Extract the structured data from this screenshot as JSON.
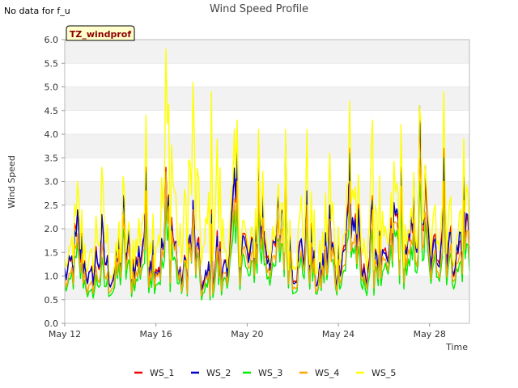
{
  "chart_data": {
    "type": "line",
    "title": "Wind Speed Profile",
    "note": "No data for f_u",
    "tag": "TZ_windprof",
    "xlabel": "Time",
    "ylabel": "Wind Speed",
    "ylim": [
      0,
      6
    ],
    "yticks": [
      "0.0",
      "0.5",
      "1.0",
      "1.5",
      "2.0",
      "2.5",
      "3.0",
      "3.5",
      "4.0",
      "4.5",
      "5.0",
      "5.5",
      "6.0"
    ],
    "x_start": "2024-05-12",
    "x_end": "2024-05-29T18:00",
    "xticks": [
      {
        "date": "2024-05-12",
        "label": "May 12"
      },
      {
        "date": "2024-05-16",
        "label": "May 16"
      },
      {
        "date": "2024-05-20",
        "label": "May 20"
      },
      {
        "date": "2024-05-24",
        "label": "May 24"
      },
      {
        "date": "2024-05-28",
        "label": "May 28"
      }
    ],
    "grid": true,
    "legend": "bottom",
    "daily_peaks": [
      {
        "date": "2024-05-12",
        "WS_1": 2.4,
        "WS_2": 2.4,
        "WS_3": 1.7,
        "WS_4": 1.9,
        "WS_5": 3.0
      },
      {
        "date": "2024-05-13",
        "WS_1": 2.3,
        "WS_2": 2.3,
        "WS_3": 1.4,
        "WS_4": 1.7,
        "WS_5": 3.3
      },
      {
        "date": "2024-05-14",
        "WS_1": 2.7,
        "WS_2": 2.7,
        "WS_3": 2.0,
        "WS_4": 2.3,
        "WS_5": 3.1
      },
      {
        "date": "2024-05-15",
        "WS_1": 3.3,
        "WS_2": 3.2,
        "WS_3": 2.4,
        "WS_4": 2.8,
        "WS_5": 4.4
      },
      {
        "date": "2024-05-16",
        "WS_1": 3.3,
        "WS_2": 3.2,
        "WS_3": 2.6,
        "WS_4": 3.2,
        "WS_5": 5.8
      },
      {
        "date": "2024-05-17",
        "WS_1": 2.6,
        "WS_2": 2.6,
        "WS_3": 2.2,
        "WS_4": 2.4,
        "WS_5": 5.1
      },
      {
        "date": "2024-05-18",
        "WS_1": 2.4,
        "WS_2": 2.3,
        "WS_3": 1.8,
        "WS_4": 2.1,
        "WS_5": 4.9
      },
      {
        "date": "2024-05-19",
        "WS_1": 3.7,
        "WS_2": 3.6,
        "WS_3": 2.6,
        "WS_4": 3.0,
        "WS_5": 4.3
      },
      {
        "date": "2024-05-20",
        "WS_1": 3.7,
        "WS_2": 3.5,
        "WS_3": 2.6,
        "WS_4": 3.0,
        "WS_5": 4.1
      },
      {
        "date": "2024-05-21",
        "WS_1": 3.8,
        "WS_2": 3.7,
        "WS_3": 2.7,
        "WS_4": 3.1,
        "WS_5": 4.1
      },
      {
        "date": "2024-05-22",
        "WS_1": 2.8,
        "WS_2": 2.8,
        "WS_3": 2.2,
        "WS_4": 2.5,
        "WS_5": 4.1
      },
      {
        "date": "2024-05-23",
        "WS_1": 2.5,
        "WS_2": 2.5,
        "WS_3": 2.0,
        "WS_4": 2.2,
        "WS_5": 3.6
      },
      {
        "date": "2024-05-24",
        "WS_1": 3.7,
        "WS_2": 3.6,
        "WS_3": 2.6,
        "WS_4": 3.0,
        "WS_5": 4.7
      },
      {
        "date": "2024-05-25",
        "WS_1": 2.7,
        "WS_2": 2.6,
        "WS_3": 2.0,
        "WS_4": 2.4,
        "WS_5": 4.3
      },
      {
        "date": "2024-05-26",
        "WS_1": 3.3,
        "WS_2": 3.2,
        "WS_3": 2.6,
        "WS_4": 2.9,
        "WS_5": 4.2
      },
      {
        "date": "2024-05-27",
        "WS_1": 4.3,
        "WS_2": 4.6,
        "WS_3": 3.0,
        "WS_4": 3.5,
        "WS_5": 4.6
      },
      {
        "date": "2024-05-28",
        "WS_1": 3.7,
        "WS_2": 3.5,
        "WS_3": 2.7,
        "WS_4": 3.0,
        "WS_5": 4.9
      },
      {
        "date": "2024-05-29",
        "WS_1": 2.9,
        "WS_2": 3.2,
        "WS_3": 2.2,
        "WS_4": 2.6,
        "WS_5": 3.9
      }
    ],
    "daily_lows": [
      0.6,
      0.5,
      0.4,
      0.5,
      0.5,
      0.4,
      0.3,
      0.6,
      0.6,
      0.6,
      0.5,
      0.4,
      0.6,
      0.5,
      0.6,
      0.7,
      0.6,
      0.7
    ],
    "series": [
      {
        "name": "WS_1",
        "color": "#ee0000"
      },
      {
        "name": "WS_2",
        "color": "#0000cc"
      },
      {
        "name": "WS_3",
        "color": "#00ee00"
      },
      {
        "name": "WS_4",
        "color": "#ffa500"
      },
      {
        "name": "WS_5",
        "color": "#ffff00"
      }
    ]
  },
  "colors": {
    "band": "#f2f2f2",
    "grid": "#dddddd",
    "axis": "#bbbbbb",
    "tag_bg": "#ffffcc"
  }
}
